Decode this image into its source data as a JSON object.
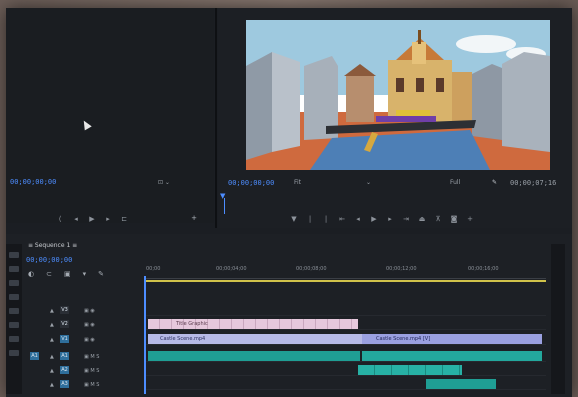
{
  "source_monitor": {
    "timecode": "00;00;00;00",
    "zoom_glyph": "⊡ ⌄"
  },
  "program_monitor": {
    "timecode": "00;00;00;00",
    "fit_label": "Fit",
    "quality_label": "Full",
    "end_timecode": "00;00;07;16",
    "wrench_icon": "wrench-icon"
  },
  "timeline": {
    "tab_label": "≡ Sequence 1 ≡",
    "timecode": "00;00;00;00",
    "ruler_labels": [
      "00;00",
      "00;00;04;00",
      "00;00;08;00",
      "00;00;12;00",
      "00;00;16;00"
    ],
    "tracks": [
      {
        "name": "V3",
        "label": "V3"
      },
      {
        "name": "V2",
        "label": "V2"
      },
      {
        "name": "V1",
        "label": "V1"
      },
      {
        "name": "A1",
        "label": "A1"
      },
      {
        "name": "A2",
        "label": "A2"
      },
      {
        "name": "A3",
        "label": "A3"
      }
    ],
    "clips": [
      {
        "label": "Title Graphic"
      },
      {
        "label": "Castle Scene.mp4"
      },
      {
        "label": "Castle Scene.mp4 [V]"
      }
    ]
  }
}
